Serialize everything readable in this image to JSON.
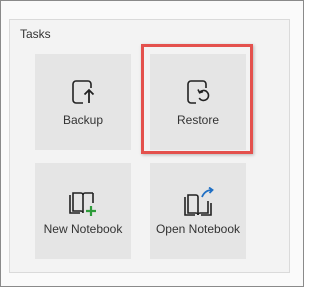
{
  "panel": {
    "title": "Tasks"
  },
  "tiles": [
    {
      "label": "Backup",
      "icon": "backup-icon"
    },
    {
      "label": "Restore",
      "icon": "restore-icon"
    },
    {
      "label": "New Notebook",
      "icon": "new-notebook-icon"
    },
    {
      "label": "Open Notebook",
      "icon": "open-notebook-icon"
    }
  ],
  "colors": {
    "tile_bg": "#e5e5e5",
    "highlight": "#e4514d",
    "new_accent": "#2e9c3a",
    "open_accent": "#1f6fc4"
  }
}
